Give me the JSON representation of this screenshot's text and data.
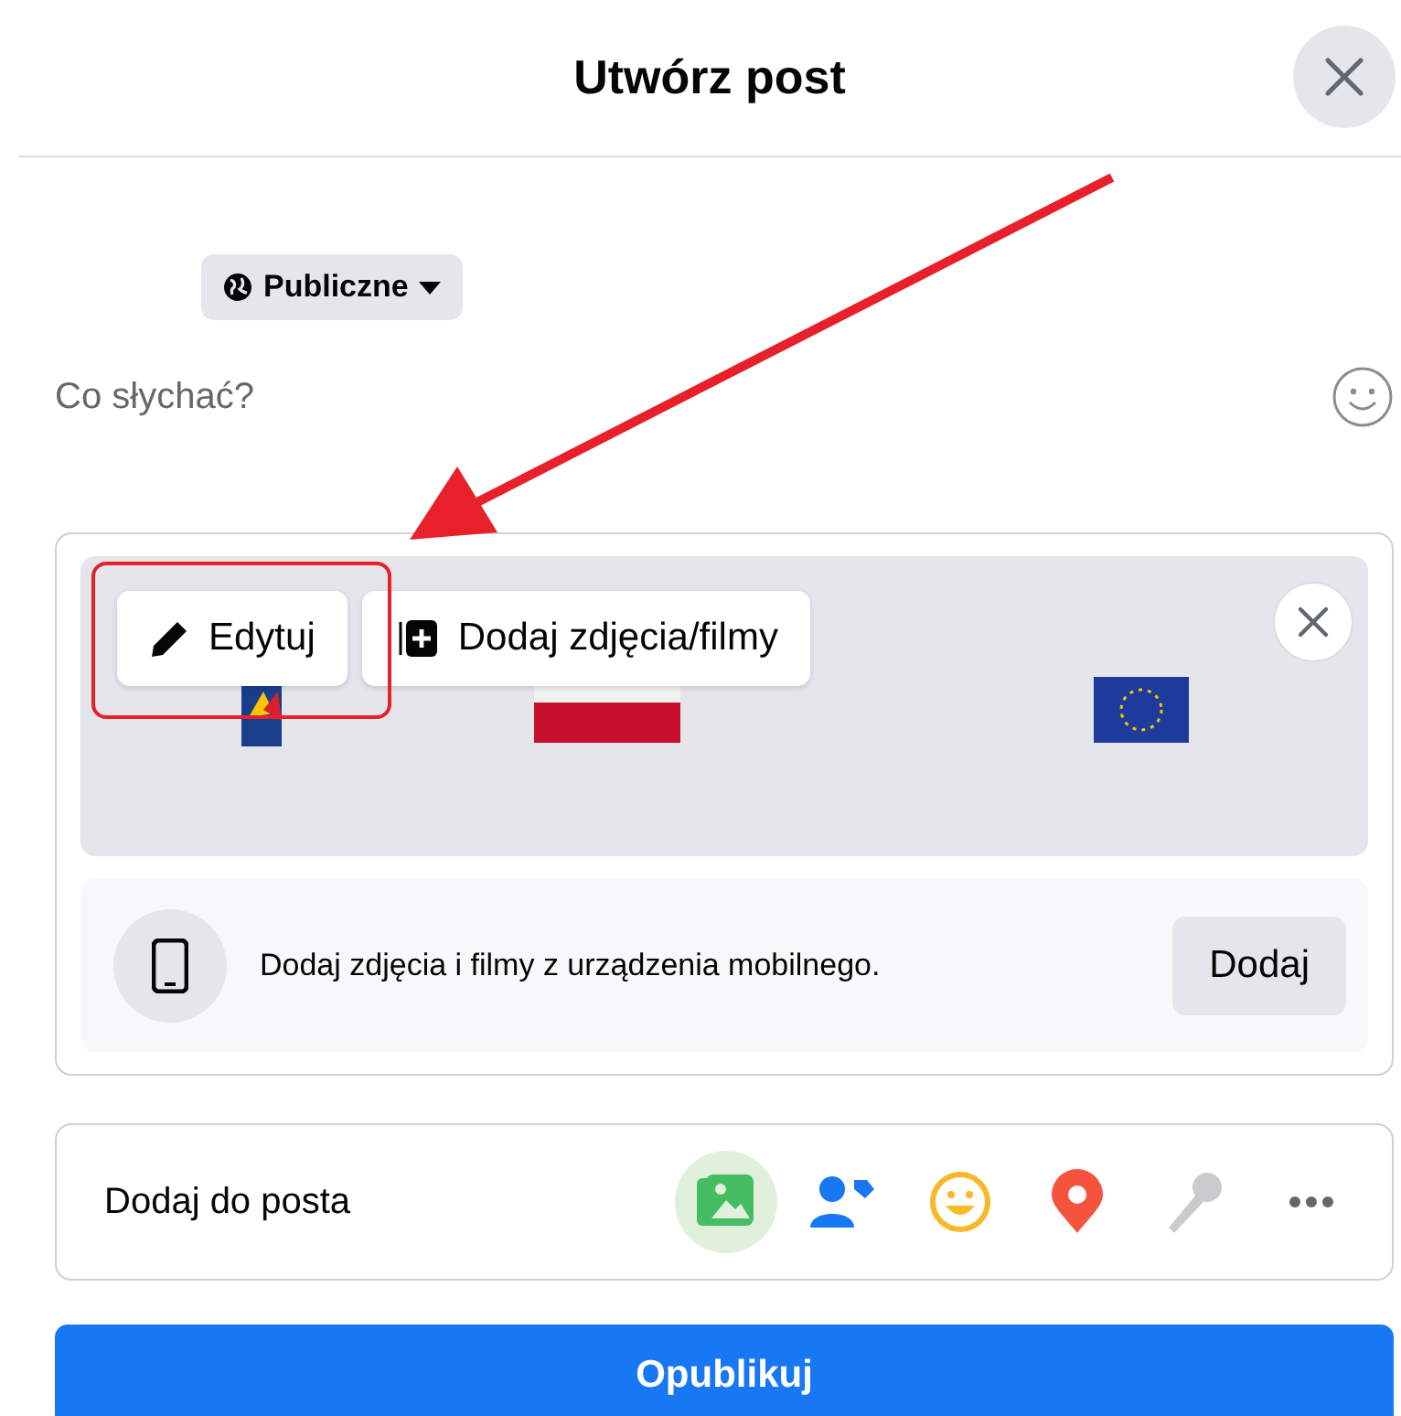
{
  "dialog": {
    "title": "Utwórz post"
  },
  "audience": {
    "label": "Publiczne"
  },
  "composer": {
    "placeholder": "Co słychać?"
  },
  "attachment": {
    "edit_button": "Edytuj",
    "add_button": "Dodaj zdjęcia/filmy"
  },
  "mobile": {
    "text": "Dodaj zdjęcia i filmy z urządzenia mobilnego.",
    "button": "Dodaj"
  },
  "add_to_post": {
    "label": "Dodaj do posta",
    "tools": [
      {
        "kind": "photo",
        "selected": true,
        "disabled": false
      },
      {
        "kind": "tag",
        "selected": false,
        "disabled": false
      },
      {
        "kind": "feeling",
        "selected": false,
        "disabled": false
      },
      {
        "kind": "location",
        "selected": false,
        "disabled": false
      },
      {
        "kind": "mic",
        "selected": false,
        "disabled": true
      },
      {
        "kind": "more",
        "selected": false,
        "disabled": false
      }
    ]
  },
  "publish_button": "Opublikuj"
}
